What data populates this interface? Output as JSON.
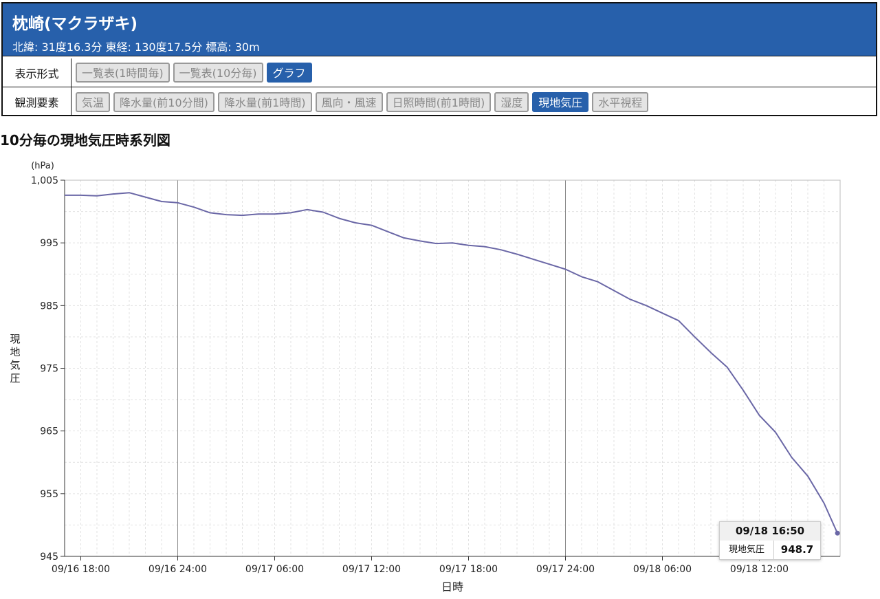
{
  "station": {
    "name": "枕崎(マクラザキ)",
    "meta": "北緯: 31度16.3分 東経: 130度17.5分 標高: 30m"
  },
  "display_format": {
    "label": "表示形式",
    "buttons": [
      "一覧表(1時間毎)",
      "一覧表(10分毎)",
      "グラフ"
    ],
    "active": "グラフ"
  },
  "elements": {
    "label": "観測要素",
    "buttons": [
      "気温",
      "降水量(前10分間)",
      "降水量(前1時間)",
      "風向・風速",
      "日照時間(前1時間)",
      "湿度",
      "現地気圧",
      "水平視程"
    ],
    "active": "現地気圧"
  },
  "graph_title": "10分毎の現地気圧時系列図",
  "tooltip": {
    "time": "09/18 16:50",
    "label": "現地気圧",
    "value": "948.7"
  },
  "colors": {
    "header": "#2760ab",
    "line": "#6a67a6",
    "active_button": "#2760ab"
  },
  "chart_data": {
    "type": "line",
    "unit": "(hPa)",
    "ylabel": "現地気圧",
    "xlabel": "日時",
    "ylim": [
      945,
      1005
    ],
    "y_ticks": [
      "1,005",
      "995",
      "985",
      "975",
      "965",
      "955",
      "945"
    ],
    "x_ticks": [
      "09/16 18:00",
      "09/16 24:00",
      "09/17 06:00",
      "09/17 12:00",
      "09/17 18:00",
      "09/17 24:00",
      "09/18 06:00",
      "09/18 12:00"
    ],
    "x_start": "09/16 17:00",
    "x_end": "09/18 17:00",
    "grid": true,
    "series": [
      {
        "name": "現地気圧",
        "points": [
          [
            "09/16 17:00",
            1002.6
          ],
          [
            "09/16 18:00",
            1002.6
          ],
          [
            "09/16 19:00",
            1002.5
          ],
          [
            "09/16 20:00",
            1002.8
          ],
          [
            "09/16 21:00",
            1003.0
          ],
          [
            "09/16 22:00",
            1002.3
          ],
          [
            "09/16 23:00",
            1001.6
          ],
          [
            "09/17 00:00",
            1001.4
          ],
          [
            "09/17 01:00",
            1000.7
          ],
          [
            "09/17 02:00",
            999.8
          ],
          [
            "09/17 03:00",
            999.5
          ],
          [
            "09/17 04:00",
            999.4
          ],
          [
            "09/17 05:00",
            999.6
          ],
          [
            "09/17 06:00",
            999.6
          ],
          [
            "09/17 07:00",
            999.8
          ],
          [
            "09/17 08:00",
            1000.3
          ],
          [
            "09/17 09:00",
            999.9
          ],
          [
            "09/17 10:00",
            998.9
          ],
          [
            "09/17 11:00",
            998.2
          ],
          [
            "09/17 12:00",
            997.8
          ],
          [
            "09/17 13:00",
            996.8
          ],
          [
            "09/17 14:00",
            995.8
          ],
          [
            "09/17 15:00",
            995.3
          ],
          [
            "09/17 16:00",
            994.9
          ],
          [
            "09/17 17:00",
            995.0
          ],
          [
            "09/17 18:00",
            994.6
          ],
          [
            "09/17 19:00",
            994.4
          ],
          [
            "09/17 20:00",
            993.9
          ],
          [
            "09/17 21:00",
            993.2
          ],
          [
            "09/17 22:00",
            992.4
          ],
          [
            "09/17 23:00",
            991.6
          ],
          [
            "09/18 00:00",
            990.8
          ],
          [
            "09/18 01:00",
            989.6
          ],
          [
            "09/18 02:00",
            988.8
          ],
          [
            "09/18 03:00",
            987.4
          ],
          [
            "09/18 04:00",
            986.0
          ],
          [
            "09/18 05:00",
            985.0
          ],
          [
            "09/18 06:00",
            983.8
          ],
          [
            "09/18 07:00",
            982.6
          ],
          [
            "09/18 08:00",
            980.0
          ],
          [
            "09/18 09:00",
            977.5
          ],
          [
            "09/18 10:00",
            975.2
          ],
          [
            "09/18 11:00",
            971.5
          ],
          [
            "09/18 12:00",
            967.5
          ],
          [
            "09/18 13:00",
            964.8
          ],
          [
            "09/18 14:00",
            960.8
          ],
          [
            "09/18 15:00",
            957.8
          ],
          [
            "09/18 16:00",
            953.5
          ],
          [
            "09/18 16:50",
            948.7
          ]
        ]
      }
    ]
  }
}
